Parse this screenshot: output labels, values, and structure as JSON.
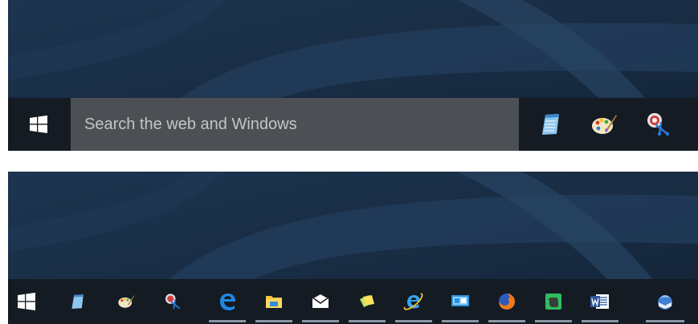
{
  "top_taskbar": {
    "start_icon": "windows-logo-icon",
    "search": {
      "placeholder": "Search the web and Windows"
    },
    "pinned": [
      {
        "icon": "notepad-icon"
      },
      {
        "icon": "paint-icon"
      },
      {
        "icon": "snipping-tool-icon"
      }
    ]
  },
  "bottom_taskbar": {
    "start_icon": "windows-logo-icon",
    "apps": [
      {
        "icon": "notepad-icon",
        "running": false
      },
      {
        "icon": "paint-icon",
        "running": false
      },
      {
        "icon": "snipping-tool-icon",
        "running": false
      },
      {
        "icon": "edge-icon",
        "running": true
      },
      {
        "icon": "file-explorer-icon",
        "running": true
      },
      {
        "icon": "mail-icon",
        "running": true
      },
      {
        "icon": "sticky-notes-icon",
        "running": true
      },
      {
        "icon": "internet-explorer-icon",
        "running": true
      },
      {
        "icon": "remote-desktop-icon",
        "running": true
      },
      {
        "icon": "firefox-icon",
        "running": true
      },
      {
        "icon": "evernote-icon",
        "running": true
      },
      {
        "icon": "word-icon",
        "running": true
      },
      {
        "icon": "thunderbird-icon",
        "running": true
      }
    ]
  },
  "colors": {
    "taskbar": "#141b23",
    "search_box": "#4c4f53",
    "wallpaper": "#1b3049",
    "running_indicator": "#8a96a3"
  }
}
